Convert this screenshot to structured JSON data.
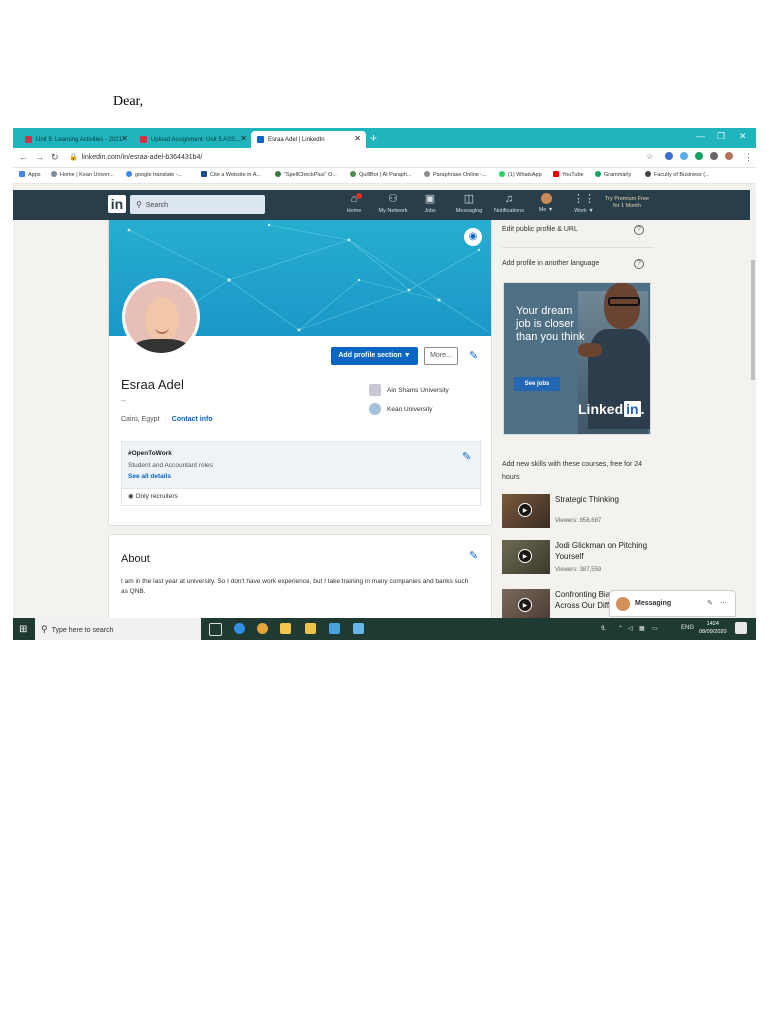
{
  "document": {
    "greeting": "Dear,"
  },
  "browser": {
    "tabs": [
      {
        "label": "Unit 5: Learning Activities - 2021"
      },
      {
        "label": "Upload Assignment: Unit 5 ASS..."
      },
      {
        "label": "Esraa Adel | LinkedIn"
      }
    ],
    "new_tab": "+",
    "url": "linkedin.com/in/esraa-adel-b364431b4/",
    "bookmarks": [
      "Apps",
      "Home | Kean Univer...",
      "google translate -...",
      "Cite a Website in A...",
      "\"SpellCheckPlus\" O...",
      "QuillBot | AI Paraph...",
      "Paraphrase Online -...",
      "(1) WhatsApp",
      "YouTube",
      "Grammarly",
      "Faculty of Business (..."
    ]
  },
  "linkedin": {
    "logo": "in",
    "search_placeholder": "Search",
    "nav": [
      {
        "label": "Home",
        "icon": "home-icon"
      },
      {
        "label": "My Network",
        "icon": "network-icon"
      },
      {
        "label": "Jobs",
        "icon": "jobs-icon"
      },
      {
        "label": "Messaging",
        "icon": "messaging-icon"
      },
      {
        "label": "Notifications",
        "icon": "bell-icon"
      },
      {
        "label": "Me ▼",
        "icon": "avatar-icon"
      },
      {
        "label": "Work ▼",
        "icon": "grid-icon"
      }
    ],
    "premium": [
      "Try Premium Free",
      "for 1 Month"
    ]
  },
  "profile": {
    "name": "Esraa Adel",
    "headline": "--",
    "location": "Cairo, Egypt",
    "separator": "·",
    "contact_info": "Contact info",
    "add_section": "Add profile section ▼",
    "more": "More...",
    "education": [
      "Ain Shams University",
      "Kean University"
    ],
    "open_to_work": {
      "title": "#OpenToWork",
      "roles": "Student and Accountant roles",
      "see_all": "See all details",
      "visibility": "Only recruiters"
    }
  },
  "about": {
    "title": "About",
    "text": "I am in the last year at university. So I don't have work experience, but I take training in many companies and banks such as QNB."
  },
  "sidebar": {
    "edit_profile": "Edit public profile & URL",
    "add_language": "Add profile in another language",
    "ad": {
      "copy": "Your dream job is closer than you think",
      "cta": "See jobs",
      "brand_text": "Linked",
      "brand_box": "in",
      "brand_dot": "."
    },
    "courses_heading": "Add new skills with these courses, free for 24 hours",
    "courses": [
      {
        "title": "Strategic Thinking",
        "viewers": "Viewers: 858,687"
      },
      {
        "title": "Jodi Glickman on Pitching Yourself",
        "viewers": "Viewers: 387,559"
      },
      {
        "title": "Confronting Bias: Thriving Across Our Differences",
        "viewers": ""
      }
    ]
  },
  "messaging": {
    "label": "Messaging"
  },
  "taskbar": {
    "search_placeholder": "Type here to search",
    "lang": "ENG",
    "time": "1424",
    "date": "08/09/2020"
  },
  "colors": {
    "tabstrip": "#20b5bd",
    "linkedin_header": "#283e4a",
    "linkedin_blue": "#0a66c2",
    "taskbar": "#1f3a33"
  }
}
